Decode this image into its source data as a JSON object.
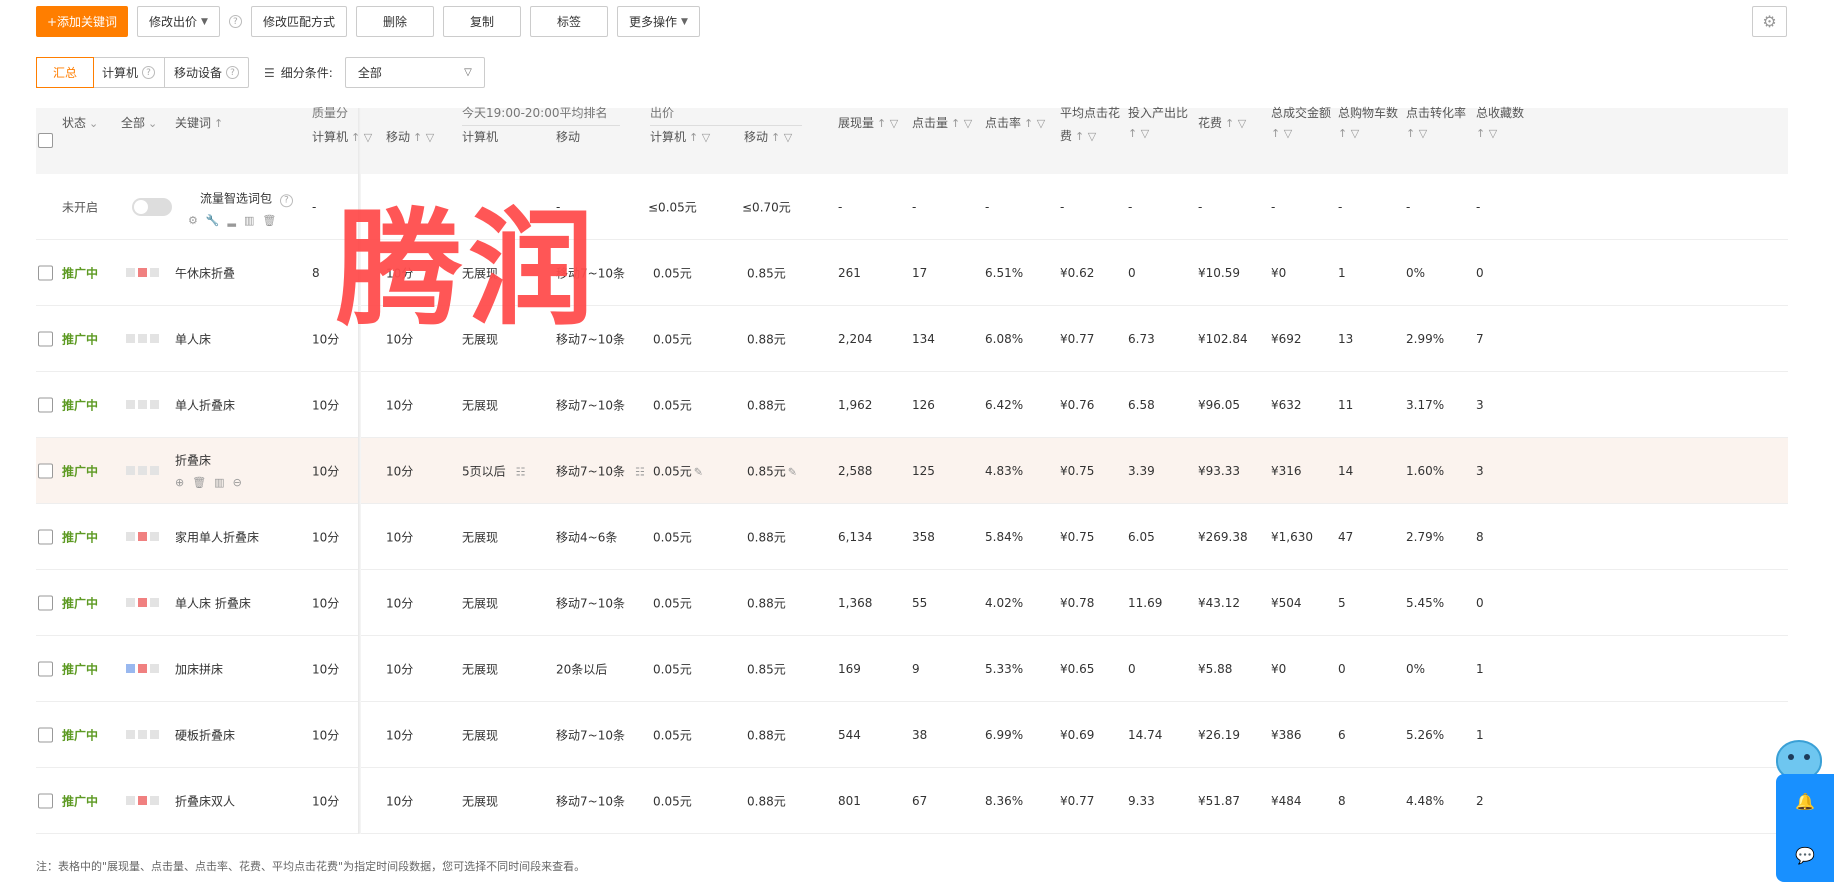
{
  "toolbar": {
    "add_keyword": "+添加关键词",
    "modify_bid": "修改出价",
    "modify_match": "修改匹配方式",
    "delete": "删除",
    "copy": "复制",
    "tag": "标签",
    "more_actions": "更多操作"
  },
  "segments": {
    "summary": "汇总",
    "computer": "计算机",
    "mobile": "移动设备"
  },
  "filter": {
    "label": "细分条件:",
    "value": "全部"
  },
  "headers": {
    "status": "状态",
    "all": "全部",
    "keyword": "关键词",
    "quality": "质量分",
    "quality_pc": "计算机",
    "quality_mobile": "移动",
    "rank_group": "今天19:00-20:00平均排名",
    "rank_pc": "计算机",
    "rank_mobile": "移动",
    "bid_group": "出价",
    "bid_pc": "计算机",
    "bid_mobile": "移动",
    "impressions": "展现量",
    "clicks": "点击量",
    "ctr": "点击率",
    "avg_cpc_line1": "平均点击花",
    "avg_cpc_line2": "费",
    "roi": "投入产出比",
    "cost": "花费",
    "gmv": "总成交金额",
    "cart": "总购物车数",
    "cvr": "点击转化率",
    "fav": "总收藏数"
  },
  "package_row": {
    "status": "未开启",
    "keyword": "流量智选词包",
    "quality_pc": "-",
    "rank_mobile": "-",
    "bid_pc": "≤0.05元",
    "bid_mobile": "≤0.70元",
    "rest": [
      "-",
      "-",
      "-",
      "-",
      "-",
      "-",
      "-",
      "-",
      "-",
      "-"
    ]
  },
  "rows": [
    {
      "status": "推广中",
      "squares": [
        "g",
        "r",
        "g"
      ],
      "keyword": "午休床折叠",
      "q_pc": "8",
      "q_mobile": "10分",
      "rank_pc": "无展现",
      "rank_mobile": "移动7~10条",
      "bid_pc": "0.05元",
      "bid_mobile": "0.85元",
      "impr": "261",
      "clicks": "17",
      "ctr": "6.51%",
      "cpc": "¥0.62",
      "roi": "0",
      "cost": "¥10.59",
      "gmv": "¥0",
      "cart": "1",
      "cvr": "0%",
      "fav": "0"
    },
    {
      "status": "推广中",
      "squares": [
        "g",
        "g",
        "g"
      ],
      "keyword": "单人床",
      "q_pc": "10分",
      "q_mobile": "10分",
      "rank_pc": "无展现",
      "rank_mobile": "移动7~10条",
      "bid_pc": "0.05元",
      "bid_mobile": "0.88元",
      "impr": "2,204",
      "clicks": "134",
      "ctr": "6.08%",
      "cpc": "¥0.77",
      "roi": "6.73",
      "cost": "¥102.84",
      "gmv": "¥692",
      "cart": "13",
      "cvr": "2.99%",
      "fav": "7"
    },
    {
      "status": "推广中",
      "squares": [
        "g",
        "g",
        "g"
      ],
      "keyword": "单人折叠床",
      "q_pc": "10分",
      "q_mobile": "10分",
      "rank_pc": "无展现",
      "rank_mobile": "移动7~10条",
      "bid_pc": "0.05元",
      "bid_mobile": "0.88元",
      "impr": "1,962",
      "clicks": "126",
      "ctr": "6.42%",
      "cpc": "¥0.76",
      "roi": "6.58",
      "cost": "¥96.05",
      "gmv": "¥632",
      "cart": "11",
      "cvr": "3.17%",
      "fav": "3"
    },
    {
      "status": "推广中",
      "squares": [
        "g",
        "g",
        "g"
      ],
      "keyword": "折叠床",
      "q_pc": "10分",
      "q_mobile": "10分",
      "rank_pc": "5页以后",
      "rank_mobile": "移动7~10条",
      "bid_pc": "0.05元",
      "bid_mobile": "0.85元",
      "impr": "2,588",
      "clicks": "125",
      "ctr": "4.83%",
      "cpc": "¥0.75",
      "roi": "3.39",
      "cost": "¥93.33",
      "gmv": "¥316",
      "cart": "14",
      "cvr": "1.60%",
      "fav": "3"
    },
    {
      "status": "推广中",
      "squares": [
        "g",
        "r",
        "g"
      ],
      "keyword": "家用单人折叠床",
      "q_pc": "10分",
      "q_mobile": "10分",
      "rank_pc": "无展现",
      "rank_mobile": "移动4~6条",
      "bid_pc": "0.05元",
      "bid_mobile": "0.88元",
      "impr": "6,134",
      "clicks": "358",
      "ctr": "5.84%",
      "cpc": "¥0.75",
      "roi": "6.05",
      "cost": "¥269.38",
      "gmv": "¥1,630",
      "cart": "47",
      "cvr": "2.79%",
      "fav": "8"
    },
    {
      "status": "推广中",
      "squares": [
        "g",
        "r",
        "g"
      ],
      "keyword": "单人床 折叠床",
      "q_pc": "10分",
      "q_mobile": "10分",
      "rank_pc": "无展现",
      "rank_mobile": "移动7~10条",
      "bid_pc": "0.05元",
      "bid_mobile": "0.88元",
      "impr": "1,368",
      "clicks": "55",
      "ctr": "4.02%",
      "cpc": "¥0.78",
      "roi": "11.69",
      "cost": "¥43.12",
      "gmv": "¥504",
      "cart": "5",
      "cvr": "5.45%",
      "fav": "0"
    },
    {
      "status": "推广中",
      "squares": [
        "b",
        "r",
        "g"
      ],
      "keyword": "加床拼床",
      "q_pc": "10分",
      "q_mobile": "10分",
      "rank_pc": "无展现",
      "rank_mobile": "20条以后",
      "bid_pc": "0.05元",
      "bid_mobile": "0.85元",
      "impr": "169",
      "clicks": "9",
      "ctr": "5.33%",
      "cpc": "¥0.65",
      "roi": "0",
      "cost": "¥5.88",
      "gmv": "¥0",
      "cart": "0",
      "cvr": "0%",
      "fav": "1"
    },
    {
      "status": "推广中",
      "squares": [
        "g",
        "g",
        "g"
      ],
      "keyword": "硬板折叠床",
      "q_pc": "10分",
      "q_mobile": "10分",
      "rank_pc": "无展现",
      "rank_mobile": "移动7~10条",
      "bid_pc": "0.05元",
      "bid_mobile": "0.88元",
      "impr": "544",
      "clicks": "38",
      "ctr": "6.99%",
      "cpc": "¥0.69",
      "roi": "14.74",
      "cost": "¥26.19",
      "gmv": "¥386",
      "cart": "6",
      "cvr": "5.26%",
      "fav": "1"
    },
    {
      "status": "推广中",
      "squares": [
        "g",
        "r",
        "g"
      ],
      "keyword": "折叠床双人",
      "q_pc": "10分",
      "q_mobile": "10分",
      "rank_pc": "无展现",
      "rank_mobile": "移动7~10条",
      "bid_pc": "0.05元",
      "bid_mobile": "0.88元",
      "impr": "801",
      "clicks": "67",
      "ctr": "8.36%",
      "cpc": "¥0.77",
      "roi": "9.33",
      "cost": "¥51.87",
      "gmv": "¥484",
      "cart": "8",
      "cvr": "4.48%",
      "fav": "2"
    }
  ],
  "watermark": "腾润",
  "note": "注：表格中的\"展现量、点击量、点击率、花费、平均点击花费\"为指定时间段数据，您可选择不同时间段来查看。",
  "colors": {
    "accent": "#ff7e00",
    "status_on": "#5d9a23",
    "highlight_row": "#fbf3ee",
    "float_panel": "#1890ff"
  }
}
